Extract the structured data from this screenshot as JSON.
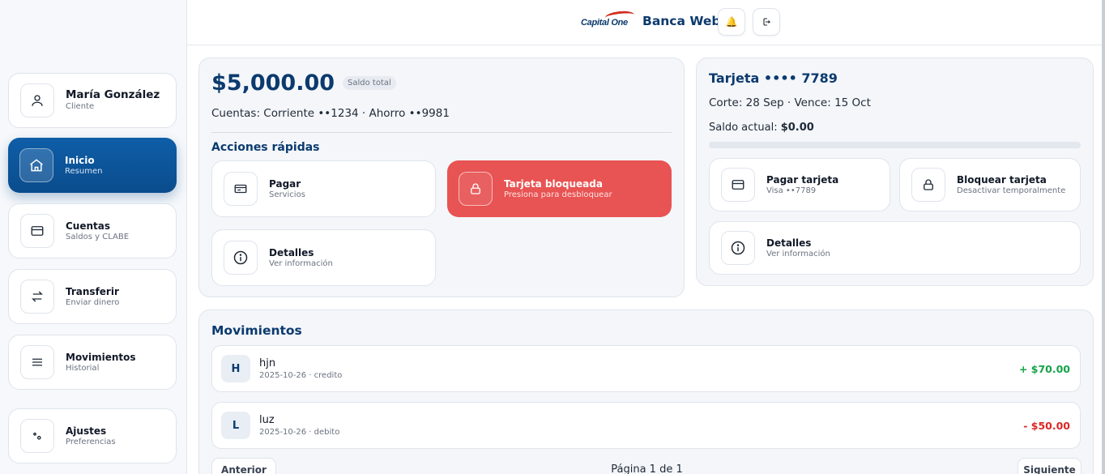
{
  "header": {
    "brand_logo_text": "Capital One",
    "app_title": "Banca Web",
    "notifications_icon": "bell-icon",
    "logout_icon": "logout-icon"
  },
  "sidebar": {
    "user": {
      "name": "María González",
      "role": "Cliente",
      "icon": "user-icon"
    },
    "items": [
      {
        "label": "Inicio",
        "sub": "Resumen",
        "icon": "home-icon",
        "active": true
      },
      {
        "label": "Cuentas",
        "sub": "Saldos y CLABE",
        "icon": "card-icon"
      },
      {
        "label": "Transferir",
        "sub": "Enviar dinero",
        "icon": "transfer-icon"
      },
      {
        "label": "Movimientos",
        "sub": "Historial",
        "icon": "menu-icon"
      },
      {
        "label": "Ajustes",
        "sub": "Preferencias",
        "icon": "settings-icon"
      }
    ]
  },
  "summary": {
    "balance": "$5,000.00",
    "balance_badge": "Saldo total",
    "accounts_line": "Cuentas: Corriente ••1234 · Ahorro ••9981",
    "quick_actions_title": "Acciones rápidas",
    "actions": [
      {
        "label": "Pagar",
        "sub": "Servicios",
        "icon": "bill-icon"
      },
      {
        "label": "Tarjeta bloqueada",
        "sub": "Presiona para desbloquear",
        "icon": "lock-icon",
        "state": "blocked"
      },
      {
        "label": "Detalles",
        "sub": "Ver información",
        "icon": "info-icon"
      }
    ]
  },
  "card": {
    "title": "Tarjeta •••• 7789",
    "dates": "Corte: 28 Sep · Vence: 15 Oct",
    "balance_label": "Saldo actual:",
    "balance_value": "$0.00",
    "usage_fraction": 0,
    "actions": [
      {
        "label": "Pagar tarjeta",
        "sub": "Visa ••7789",
        "icon": "card-icon"
      },
      {
        "label": "Bloquear tarjeta",
        "sub": "Desactivar temporalmente",
        "icon": "lock-icon"
      },
      {
        "label": "Detalles",
        "sub": "Ver información",
        "icon": "info-icon"
      }
    ]
  },
  "movements": {
    "title": "Movimientos",
    "rows": [
      {
        "initial": "H",
        "name": "hjn",
        "meta": "2025-10-26 · credito",
        "amount": "+ $70.00",
        "kind": "credit"
      },
      {
        "initial": "L",
        "name": "luz",
        "meta": "2025-10-26 · debito",
        "amount": "- $50.00",
        "kind": "debit"
      }
    ],
    "pagination": {
      "prev": "Anterior",
      "label": "Página 1 de 1",
      "next": "Siguiente"
    }
  },
  "colors": {
    "primary": "#0b3a6e",
    "active_nav": "#0f5ea8",
    "danger": "#e85353",
    "credit": "#16a34a",
    "debit": "#dc2626"
  }
}
